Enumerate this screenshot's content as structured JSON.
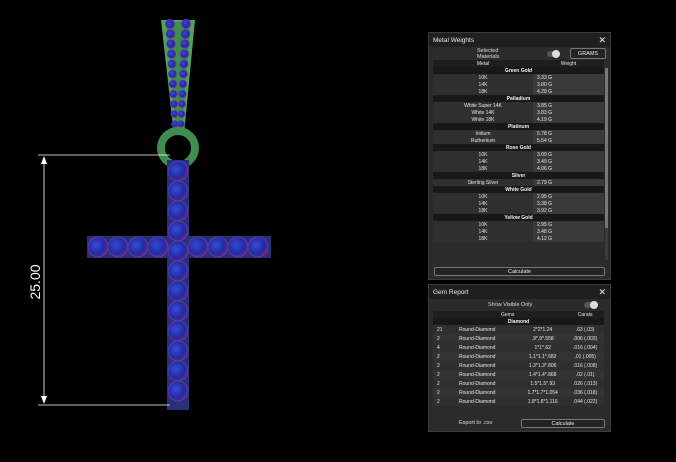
{
  "dimension": {
    "value": "25.00"
  },
  "metal_panel": {
    "title": "Metal Weights",
    "selected_materials_label": "Selected Materials",
    "grams_label": "GRAMS",
    "col_metal": "Metal",
    "col_weight": "Weight",
    "groups": [
      {
        "name": "Green Gold",
        "rows": [
          [
            "10K",
            "3.33 G"
          ],
          [
            "14K",
            "3.80 G"
          ],
          [
            "18K",
            "4.28 G"
          ]
        ]
      },
      {
        "name": "Palladium",
        "rows": [
          [
            "White Super 14K",
            "3.85 G"
          ],
          [
            "White 14K",
            "3.83 G"
          ],
          [
            "White 18K",
            "4.19 G"
          ]
        ]
      },
      {
        "name": "Platinum",
        "rows": [
          [
            "Iridium",
            "5.78 G"
          ],
          [
            "Ruthenium",
            "5.54 G"
          ]
        ]
      },
      {
        "name": "Rose Gold",
        "rows": [
          [
            "10K",
            "3.09 G"
          ],
          [
            "14K",
            "3.49 G"
          ],
          [
            "18K",
            "4.06 G"
          ]
        ]
      },
      {
        "name": "Silver",
        "rows": [
          [
            "Sterling Silver",
            "2.79 G"
          ]
        ]
      },
      {
        "name": "White Gold",
        "rows": [
          [
            "10K",
            "2.95 G"
          ],
          [
            "14K",
            "3.38 G"
          ],
          [
            "18K",
            "3.92 G"
          ]
        ]
      },
      {
        "name": "Yellow Gold",
        "rows": [
          [
            "10K",
            "2.95 G"
          ],
          [
            "14K",
            "3.48 G"
          ],
          [
            "18K",
            "4.12 G"
          ]
        ]
      }
    ],
    "calculate_label": "Calculate"
  },
  "gem_panel": {
    "title": "Gem Report",
    "show_visible_label": "Show Visible Only",
    "col_gems": "Gems",
    "col_carats": "Carats",
    "group": "Diamond",
    "rows": [
      [
        "21",
        "Round-Diamond",
        "2*2*1.24",
        ".63 (.03)"
      ],
      [
        "2",
        "Round-Diamond",
        ".9*.9*.558",
        ".006 (.003)"
      ],
      [
        "4",
        "Round-Diamond",
        "1*1*.62",
        ".016 (.004)"
      ],
      [
        "2",
        "Round-Diamond",
        "1.1*1.1*.682",
        ".01 (.005)"
      ],
      [
        "2",
        "Round-Diamond",
        "1.3*1.3*.806",
        ".016 (.008)"
      ],
      [
        "2",
        "Round-Diamond",
        "1.4*1.4*.868",
        ".02 (.01)"
      ],
      [
        "2",
        "Round-Diamond",
        "1.5*1.5*.93",
        ".026 (.013)"
      ],
      [
        "2",
        "Round-Diamond",
        "1.7*1.7*1.054",
        ".036 (.018)"
      ],
      [
        "2",
        "Round-Diamond",
        "1.8*1.8*1.116",
        ".044 (.022)"
      ]
    ],
    "export_label": "Export to .csv",
    "calculate_label": "Calculate"
  }
}
